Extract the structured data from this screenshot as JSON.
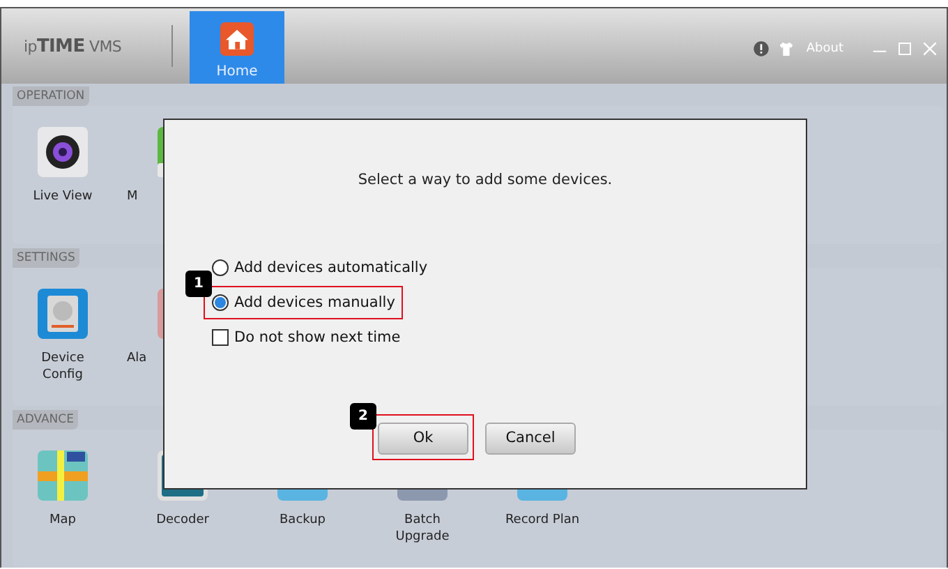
{
  "window": {
    "logo": "ip**TIME** VMS",
    "tabs": [
      {
        "label": "Home",
        "selected": true
      }
    ],
    "about": "About"
  },
  "sections": [
    {
      "title": "OPERATION",
      "items": [
        {
          "label": "Live View"
        },
        {
          "label": "M",
          "clipped": true
        }
      ]
    },
    {
      "title": "SETTINGS",
      "items": [
        {
          "label": "Device\nConfig"
        },
        {
          "label": "Ala",
          "clipped": true
        }
      ]
    },
    {
      "title": "ADVANCE",
      "items": [
        {
          "label": "Map"
        },
        {
          "label": "Decoder"
        },
        {
          "label": "Backup"
        },
        {
          "label": "Batch\nUpgrade"
        },
        {
          "label": "Record Plan"
        }
      ]
    }
  ],
  "dialog": {
    "message": "Select a way to add some devices.",
    "options": [
      {
        "kind": "radio",
        "label": "Add devices automatically",
        "selected": false
      },
      {
        "kind": "radio",
        "label": "Add devices manually",
        "selected": true,
        "callout": "1"
      },
      {
        "kind": "checkbox",
        "label": "Do not show next time",
        "checked": false
      }
    ],
    "buttons": [
      {
        "label": "Ok",
        "callout": "2"
      },
      {
        "label": "Cancel"
      }
    ]
  }
}
